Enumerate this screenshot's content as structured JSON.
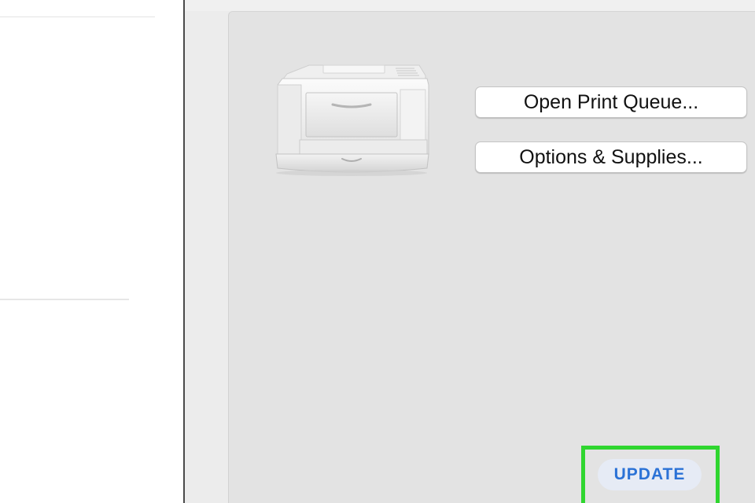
{
  "printer_panel": {
    "open_print_queue_label": "Open Print Queue...",
    "options_supplies_label": "Options & Supplies..."
  },
  "update_button": {
    "label": "UPDATE",
    "text_color": "#2b72d6",
    "highlight_color": "#2fd62f"
  },
  "icons": {
    "printer": "printer-icon"
  }
}
